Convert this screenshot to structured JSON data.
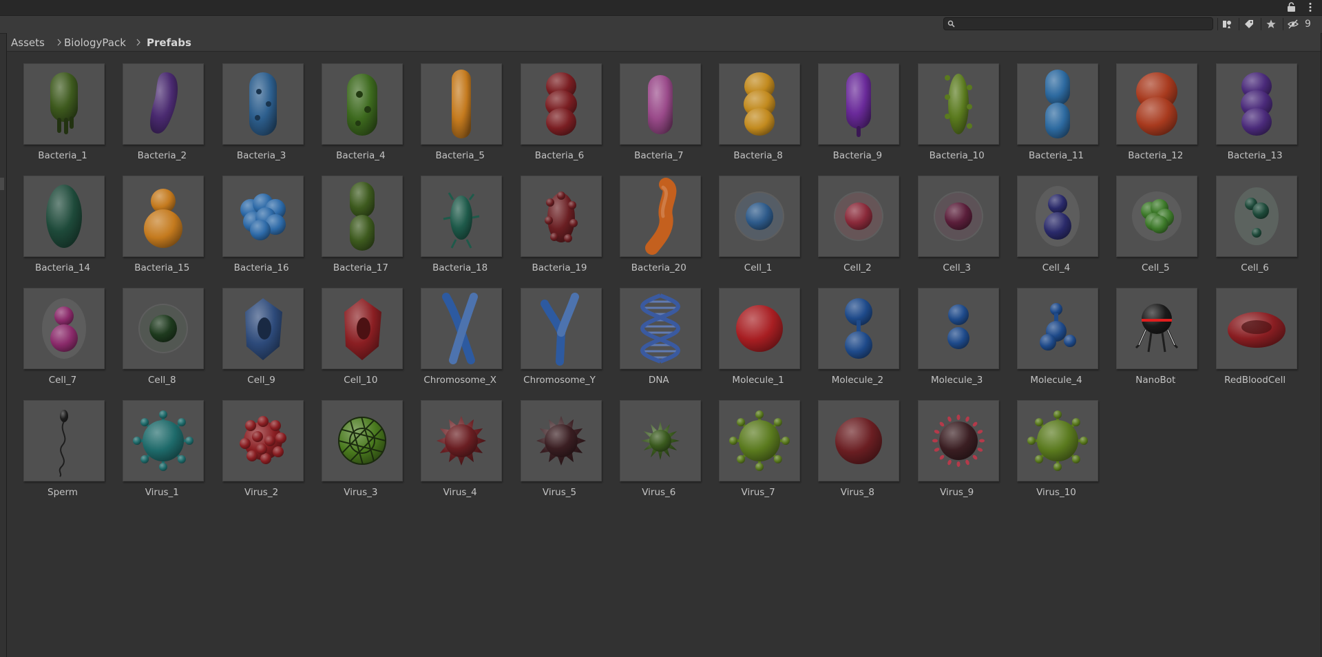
{
  "window": {
    "hidden_count": "9"
  },
  "search": {
    "value": "",
    "placeholder": ""
  },
  "icons": [
    "lock-icon",
    "more-icon",
    "search-icon",
    "filter-by-type-icon",
    "filter-by-label-icon",
    "favorites-star-icon",
    "hidden-visibility-icon",
    "breadcrumb-chevron-icon"
  ],
  "breadcrumb": [
    "Assets",
    "BiologyPack",
    "Prefabs"
  ],
  "assets": [
    {
      "name": "Bacteria_1",
      "shape": "pill-legs",
      "color": "#3e5a1e"
    },
    {
      "name": "Bacteria_2",
      "shape": "curved",
      "color": "#4a2a70"
    },
    {
      "name": "Bacteria_3",
      "shape": "pill-bumps",
      "color": "#2d5f8e"
    },
    {
      "name": "Bacteria_4",
      "shape": "pill-holes",
      "color": "#3d6a1e"
    },
    {
      "name": "Bacteria_5",
      "shape": "rod",
      "color": "#c47a1e"
    },
    {
      "name": "Bacteria_6",
      "shape": "stack3",
      "color": "#7a1e22"
    },
    {
      "name": "Bacteria_7",
      "shape": "pill",
      "color": "#9a4a8a"
    },
    {
      "name": "Bacteria_8",
      "shape": "stack3",
      "color": "#c28a1e"
    },
    {
      "name": "Bacteria_9",
      "shape": "pill-tail",
      "color": "#6a2a9a"
    },
    {
      "name": "Bacteria_10",
      "shape": "spiky-rod",
      "color": "#5a7a1e"
    },
    {
      "name": "Bacteria_11",
      "shape": "stack2-rod",
      "color": "#2d6aa0"
    },
    {
      "name": "Bacteria_12",
      "shape": "stack2",
      "color": "#a83a1e"
    },
    {
      "name": "Bacteria_13",
      "shape": "stack3",
      "color": "#4a2a7a"
    },
    {
      "name": "Bacteria_14",
      "shape": "egg",
      "color": "#1e4a3a"
    },
    {
      "name": "Bacteria_15",
      "shape": "snowman",
      "color": "#c47a1e"
    },
    {
      "name": "Bacteria_16",
      "shape": "cluster",
      "color": "#2d6aa8"
    },
    {
      "name": "Bacteria_17",
      "shape": "stack2-rod",
      "color": "#3d5a1e"
    },
    {
      "name": "Bacteria_18",
      "shape": "spiky-small",
      "color": "#1e5a4a"
    },
    {
      "name": "Bacteria_19",
      "shape": "bumpy",
      "color": "#6a1e22"
    },
    {
      "name": "Bacteria_20",
      "shape": "worm",
      "color": "#c4601e"
    },
    {
      "name": "Cell_1",
      "shape": "cell",
      "color": "#2d5a8a"
    },
    {
      "name": "Cell_2",
      "shape": "cell",
      "color": "#8a2a3a"
    },
    {
      "name": "Cell_3",
      "shape": "cell",
      "color": "#5a1e3a"
    },
    {
      "name": "Cell_4",
      "shape": "cell2",
      "color": "#2a2a6a"
    },
    {
      "name": "Cell_5",
      "shape": "cell-blob",
      "color": "#3d7a2a"
    },
    {
      "name": "Cell_6",
      "shape": "cell3",
      "color": "#1e4a3a"
    },
    {
      "name": "Cell_7",
      "shape": "cell2",
      "color": "#8a2a6a"
    },
    {
      "name": "Cell_8",
      "shape": "cell",
      "color": "#1e3a1e"
    },
    {
      "name": "Cell_9",
      "shape": "hexcell",
      "color": "#2d4a7a"
    },
    {
      "name": "Cell_10",
      "shape": "hexcell",
      "color": "#8a1e22"
    },
    {
      "name": "Chromosome_X",
      "shape": "chromo-x",
      "color": "#2d5aa0"
    },
    {
      "name": "Chromosome_Y",
      "shape": "chromo-y",
      "color": "#2d5aa0"
    },
    {
      "name": "DNA",
      "shape": "dna",
      "color": "#3a5aa0"
    },
    {
      "name": "Molecule_1",
      "shape": "sphere",
      "color": "#a81e22"
    },
    {
      "name": "Molecule_2",
      "shape": "mol2",
      "color": "#1e4a8a"
    },
    {
      "name": "Molecule_3",
      "shape": "mol2s",
      "color": "#1e4a8a"
    },
    {
      "name": "Molecule_4",
      "shape": "mol4",
      "color": "#1e4a8a"
    },
    {
      "name": "NanoBot",
      "shape": "nanobot",
      "color": "#1a1a1a"
    },
    {
      "name": "RedBloodCell",
      "shape": "rbc",
      "color": "#8a1e22"
    },
    {
      "name": "Sperm",
      "shape": "sperm",
      "color": "#1e1e1e"
    },
    {
      "name": "Virus_1",
      "shape": "virus-knobs",
      "color": "#1e6a6a"
    },
    {
      "name": "Virus_2",
      "shape": "virus-bumps",
      "color": "#8a1e22"
    },
    {
      "name": "Virus_3",
      "shape": "virus-cage",
      "color": "#4a7a1e"
    },
    {
      "name": "Virus_4",
      "shape": "virus-spiky",
      "color": "#6a1e22"
    },
    {
      "name": "Virus_5",
      "shape": "virus-spiky",
      "color": "#3a1e22"
    },
    {
      "name": "Virus_6",
      "shape": "virus-spiky-small",
      "color": "#3a5a1e"
    },
    {
      "name": "Virus_7",
      "shape": "virus-knobs",
      "color": "#5a7a1e"
    },
    {
      "name": "Virus_8",
      "shape": "sphere",
      "color": "#6a1e22"
    },
    {
      "name": "Virus_9",
      "shape": "virus-corona",
      "color": "#3a1e22"
    },
    {
      "name": "Virus_10",
      "shape": "virus-knobs",
      "color": "#5a7a1e"
    }
  ]
}
